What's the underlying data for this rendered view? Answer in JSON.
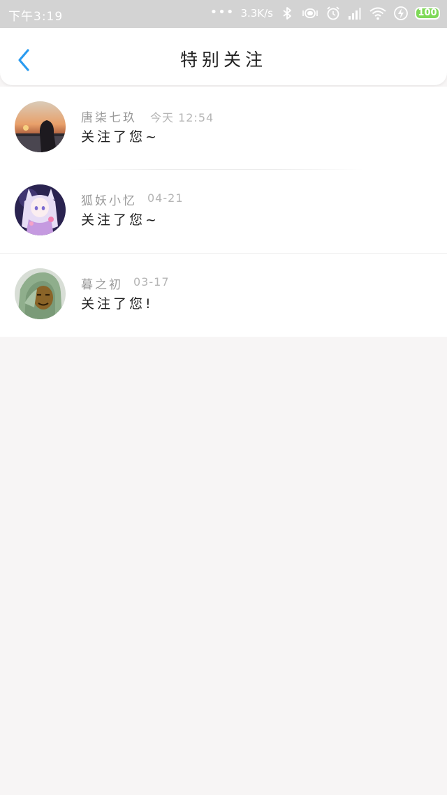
{
  "status_bar": {
    "time": "下午3:19",
    "dots": "•••",
    "net_speed": "3.3K/s",
    "battery_level": "100",
    "icons": [
      "bluetooth-icon",
      "vibrate-icon",
      "alarm-icon",
      "signal-icon",
      "wifi-icon",
      "charging-icon",
      "battery-icon"
    ]
  },
  "header": {
    "title": "特别关注",
    "back_icon": "chevron-left-icon",
    "accent_color": "#2a9bf0"
  },
  "items": [
    {
      "name": "唐柒七玖",
      "time": "今天 12:54",
      "message": "关注了您~",
      "avatar": "sunset-silhouette-avatar"
    },
    {
      "name": "狐妖小忆",
      "time": "04-21",
      "message": "关注了您~",
      "avatar": "anime-fox-girl-avatar"
    },
    {
      "name": "暮之初",
      "time": "03-17",
      "message": "关注了您!",
      "avatar": "hooded-man-avatar"
    }
  ]
}
